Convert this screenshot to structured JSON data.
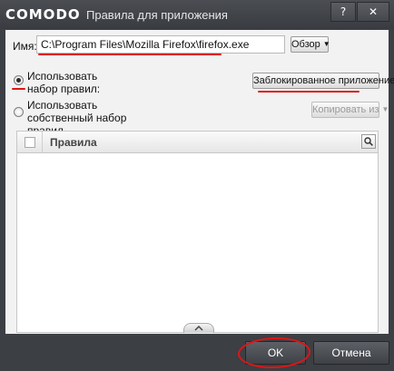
{
  "window": {
    "brand": "COMODO",
    "title": "Правила для приложения",
    "help_label": "?",
    "close_label": "✕"
  },
  "form": {
    "name_label": "Имя:",
    "name_value": "C:\\Program Files\\Mozilla Firefox\\firefox.exe",
    "browse_label": "Обзор",
    "option_use_ruleset": "Использовать набор правил:",
    "option_use_custom": "Использовать собственный набор правил",
    "ruleset_selected": "Заблокированное приложение",
    "copy_from_label": "Копировать из"
  },
  "table": {
    "header_rules": "Правила"
  },
  "footer": {
    "ok_label": "OK",
    "cancel_label": "Отмена"
  },
  "colors": {
    "annotation_red": "#e01515",
    "titlebar": "#3c3f44"
  }
}
